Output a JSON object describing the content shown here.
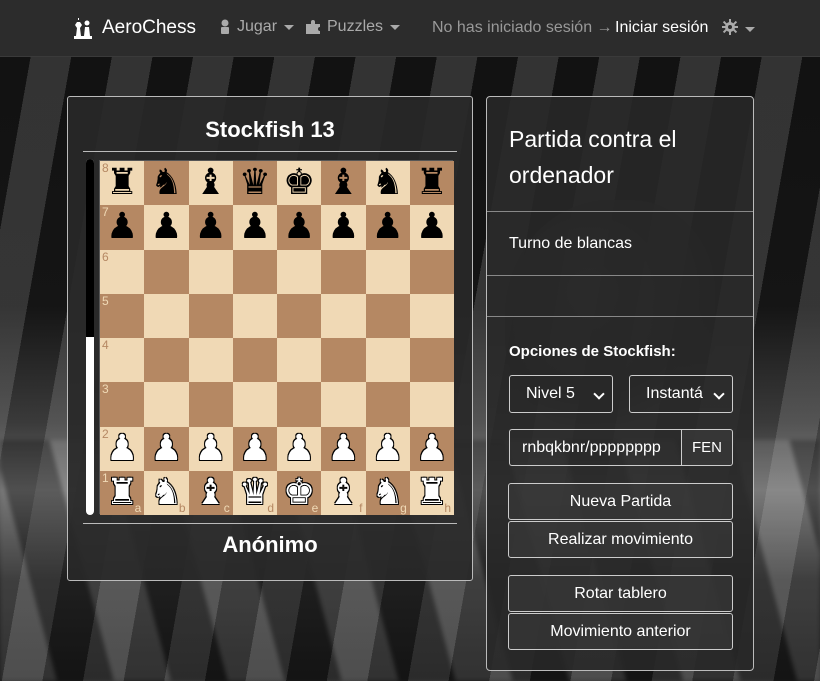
{
  "navbar": {
    "brand": "AeroChess",
    "play_label": "Jugar",
    "puzzles_label": "Puzzles",
    "status_text": "No has iniciado sesión →",
    "login_label": "Iniciar sesión"
  },
  "game": {
    "top_player": "Stockfish 13",
    "bottom_player": "Anónimo",
    "eval_black_fraction": 0.5,
    "files": [
      "a",
      "b",
      "c",
      "d",
      "e",
      "f",
      "g",
      "h"
    ],
    "ranks": [
      "8",
      "7",
      "6",
      "5",
      "4",
      "3",
      "2",
      "1"
    ],
    "position": [
      [
        "r",
        "n",
        "b",
        "q",
        "k",
        "b",
        "n",
        "r"
      ],
      [
        "p",
        "p",
        "p",
        "p",
        "p",
        "p",
        "p",
        "p"
      ],
      [
        "",
        "",
        "",
        "",
        "",
        "",
        "",
        ""
      ],
      [
        "",
        "",
        "",
        "",
        "",
        "",
        "",
        ""
      ],
      [
        "",
        "",
        "",
        "",
        "",
        "",
        "",
        ""
      ],
      [
        "",
        "",
        "",
        "",
        "",
        "",
        "",
        ""
      ],
      [
        "P",
        "P",
        "P",
        "P",
        "P",
        "P",
        "P",
        "P"
      ],
      [
        "R",
        "N",
        "B",
        "Q",
        "K",
        "B",
        "N",
        "R"
      ]
    ],
    "board_colors": {
      "light": "#f0d9b5",
      "dark": "#b58863"
    }
  },
  "side": {
    "title": "Partida contra el ordenador",
    "turn_text": "Turno de blancas",
    "options_label": "Opciones de Stockfish:",
    "level_select": "Nivel 5",
    "speed_select": "Instantá",
    "fen_value": "rnbqkbnr/pppppppp",
    "fen_button": "FEN",
    "new_game": "Nueva Partida",
    "make_move": "Realizar movimiento",
    "rotate_board": "Rotar tablero",
    "previous_move": "Movimiento anterior"
  }
}
